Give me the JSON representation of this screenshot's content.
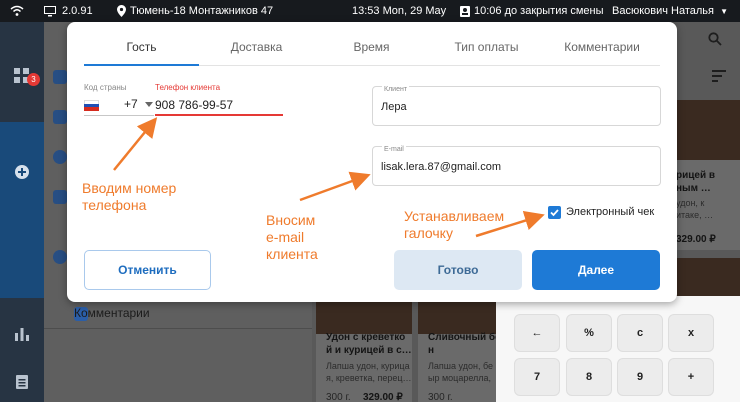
{
  "statusbar": {
    "version": "2.0.91",
    "location": "Тюмень-18 Монтажников 47",
    "datetime": "13:53  Mon, 29 May",
    "shift": "10:06 до закрытия смены",
    "user": "Васюкович Наталья"
  },
  "sidebar": {
    "badge_count": "3"
  },
  "left_panel": {
    "comments_label": "Комментарии"
  },
  "products": [
    {
      "title_line1": "Удон с креветко",
      "title_line2": "й и курицей в с…",
      "desc_line1": "Лапша удон, курица",
      "desc_line2": "я, креветка, перец…",
      "weight": "300 г.",
      "price": "329.00 ₽"
    },
    {
      "title_line1": "Сливочный бе",
      "title_line2": "н",
      "desc_line1": "Лапша удон, бе",
      "desc_line2": "ыр моцарелла,",
      "weight": "300 г."
    },
    {
      "title_line1": "рицей в",
      "title_line2": "ным …",
      "desc_line1": "удон, к",
      "desc_line2": "итаке, …",
      "price": "329.00 ₽"
    }
  ],
  "keypad": {
    "keys": [
      "←",
      "%",
      "c",
      "x",
      "7",
      "8",
      "9",
      "+"
    ]
  },
  "modal": {
    "tabs": [
      "Гость",
      "Доставка",
      "Время",
      "Тип оплаты",
      "Комментарии"
    ],
    "active_tab": "Гость",
    "country_code_label": "Код страны",
    "country_prefix": "+7",
    "phone_label": "Телефон клиента",
    "phone_value": "908 786-99-57",
    "client_label": "Клиент",
    "client_value": "Лера",
    "email_label": "E-mail",
    "email_value": "lisak.lera.87@gmail.com",
    "checkbox_label": "Электронный чек",
    "checkbox_checked": true,
    "buttons": {
      "cancel": "Отменить",
      "done": "Готово",
      "next": "Далее"
    }
  },
  "annotations": {
    "phone_line1": "Вводим номер",
    "phone_line2": "телефона",
    "email_line1": "Вносим",
    "email_line2": "e-mail",
    "email_line3": "клиента",
    "check_line1": "Устанавливаем",
    "check_line2": "галочку"
  },
  "colors": {
    "accent": "#1e7ad6",
    "annotation": "#ef7b2c",
    "error": "#e53935"
  }
}
